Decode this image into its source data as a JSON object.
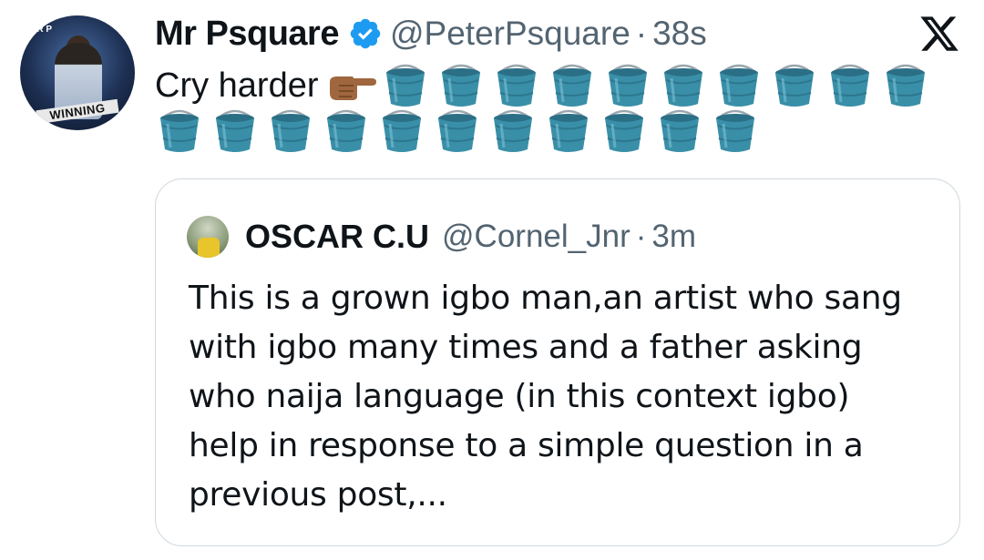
{
  "post": {
    "author_name": "Mr Psquare",
    "handle": "@PeterPsquare",
    "separator": "·",
    "time": "38s",
    "text": "Cry harder",
    "avatar_text": "WINNING",
    "avatar_corner_text": "MR P",
    "emojis": {
      "pointer": "backhand-index-pointing-right",
      "bucket": "bucket",
      "bucket_count": 21
    }
  },
  "quote": {
    "author_name": "OSCAR C.U",
    "handle": "@Cornel_Jnr",
    "separator": "·",
    "time": "3m",
    "text": "This is a grown igbo man,an artist who sang\nwith igbo many times and a father asking\nwho naija language (in this context igbo)\nhelp in response to a simple question in a\nprevious post,..."
  },
  "colors": {
    "verified": "#1d9bf0",
    "secondary_text": "#536471",
    "border": "#cfd9de",
    "bucket": "#3a8fa8"
  },
  "icons": {
    "close": "x-logo-icon",
    "verified": "verified-badge-icon"
  }
}
